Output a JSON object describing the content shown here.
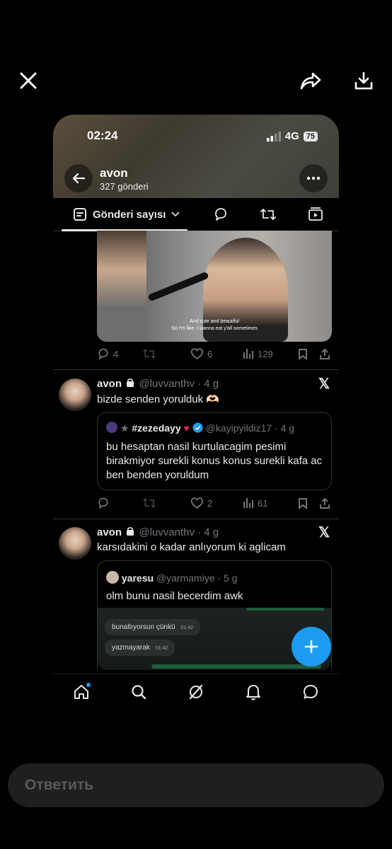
{
  "viewer": {
    "close_icon": "close-icon",
    "share_icon": "share-icon",
    "download_icon": "download-icon"
  },
  "status_bar": {
    "time": "02:24",
    "network": "4G",
    "battery": "75"
  },
  "profile": {
    "name": "avon",
    "post_count": "327 gönderi"
  },
  "tabs": {
    "active_label": "Gönderi sayısı"
  },
  "photo_subtitle": {
    "line1": "And cute and beautiful",
    "line2": "So I'm like, I wanna eat y'all sometimes"
  },
  "post0_actions": {
    "replies": "4",
    "likes": "6",
    "views": "129"
  },
  "post1": {
    "name": "avon",
    "handle": "@luvvanthv · 4 g",
    "text": "bizde senden yorulduk 🫶🏻",
    "quote": {
      "name": "#zezedayy",
      "handle": "@kayipyildiz17 · 4 g",
      "text": "bu hesaptan nasil kurtulacagim pesimi birakmiyor surekli konus konus surekli kafa ac ben benden yoruldum"
    },
    "actions": {
      "likes": "2",
      "views": "61"
    }
  },
  "post2": {
    "name": "avon",
    "handle": "@luvvanthv · 4 g",
    "text": "karsıdakini o kadar anlıyorum ki aglicam",
    "quote": {
      "name": "yaresu",
      "handle": "@yarmamiye · 5 g",
      "text": "olm bunu nasil becerdim awk"
    },
    "chat": [
      {
        "text": "bunaltıyorsun çünkü",
        "time": "01:42"
      },
      {
        "text": "yazmayarak",
        "time": "01:42"
      }
    ]
  },
  "reply_bar": {
    "placeholder": "Ответить"
  },
  "colors": {
    "accent": "#1d9bf0",
    "text": "#e7e9ea",
    "muted": "#71767b",
    "border": "#2f3336"
  }
}
